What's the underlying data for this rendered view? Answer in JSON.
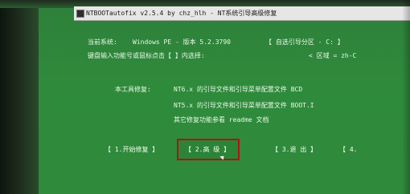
{
  "window": {
    "title": "NTBOOTautofix v2.5.4 by chz_hlh - NT系统引导高级修复"
  },
  "info": {
    "current_system_label": "当前系统:",
    "current_system_value": "Windows PE - 版本 5.2.3790",
    "boot_partition": "【 自选引导分区 - C: 】",
    "prompt": "键盘输入功能号或鼠标点击【 】内选择:",
    "zone": "< 区域 = zh-C"
  },
  "repair": {
    "heading": "本工具修复:",
    "nt6": "NT6.x 的引导文件和引导菜单配置文件 BCD",
    "nt5": "NT5.x 的引导文件和引导菜单配置文件 BOOT.I",
    "other": "其它修复功能参看 readme 文档"
  },
  "buttons": {
    "start": "【 1.开始修复 】",
    "advanced": "【 2.高  级 】",
    "exit": "【 3.退  出 】",
    "more": "【 4."
  }
}
